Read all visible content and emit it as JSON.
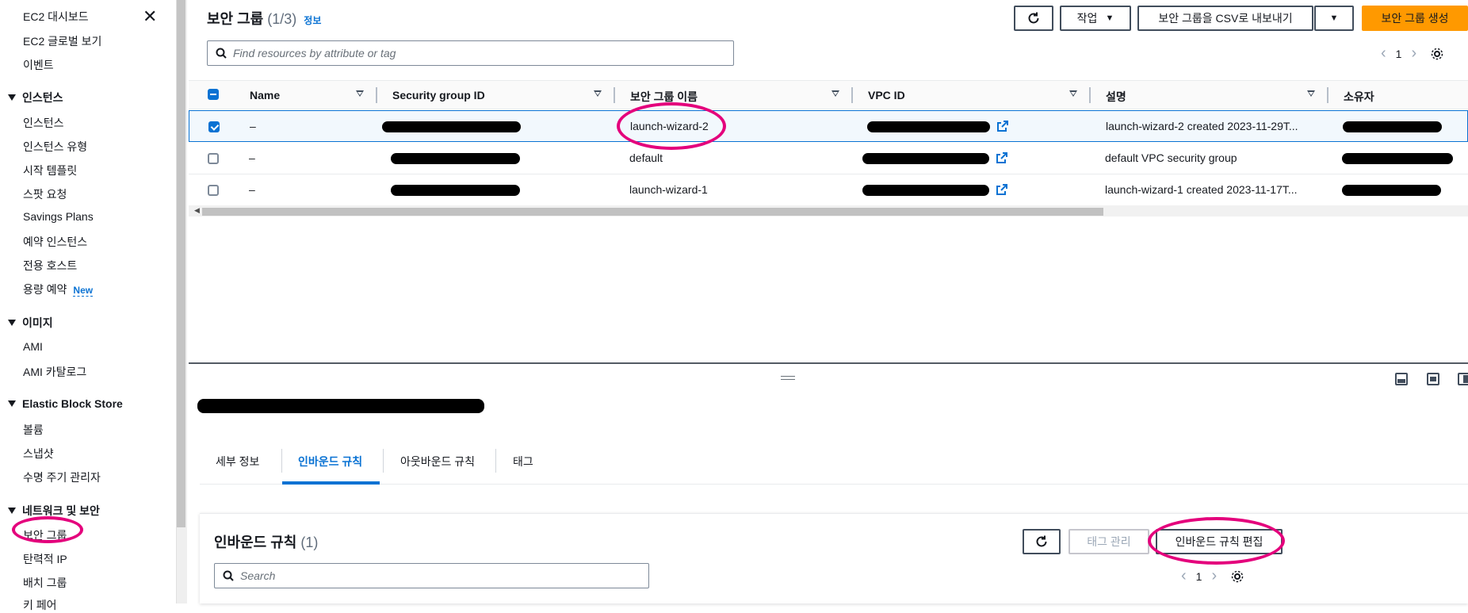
{
  "sidebar": {
    "top_items": [
      "EC2 대시보드",
      "EC2 글로벌 보기",
      "이벤트"
    ],
    "sections": [
      {
        "title": "인스턴스",
        "items": [
          "인스턴스",
          "인스턴스 유형",
          "시작 템플릿",
          "스팟 요청",
          "Savings Plans",
          "예약 인스턴스",
          "전용 호스트",
          "용량 예약"
        ]
      },
      {
        "title": "이미지",
        "items": [
          "AMI",
          "AMI 카탈로그"
        ]
      },
      {
        "title": "Elastic Block Store",
        "items": [
          "볼륨",
          "스냅샷",
          "수명 주기 관리자"
        ]
      },
      {
        "title": "네트워크 및 보안",
        "items": [
          "보안 그룹",
          "탄력적 IP",
          "배치 그룹",
          "키 페어"
        ]
      }
    ],
    "new_badge": "New"
  },
  "header": {
    "title": "보안 그룹",
    "count": "(1/3)",
    "info_link": "정보",
    "buttons": {
      "actions": "작업",
      "export": "보안 그룹을 CSV로 내보내기",
      "create": "보안 그룹 생성"
    },
    "search_placeholder": "Find resources by attribute or tag",
    "page": "1"
  },
  "table": {
    "columns": [
      "Name",
      "Security group ID",
      "보안 그룹 이름",
      "VPC ID",
      "설명",
      "소유자"
    ],
    "rows": [
      {
        "name": "–",
        "group_name": "launch-wizard-2",
        "description": "launch-wizard-2 created 2023-11-29T...",
        "selected": true
      },
      {
        "name": "–",
        "group_name": "default",
        "description": "default VPC security group",
        "selected": false
      },
      {
        "name": "–",
        "group_name": "launch-wizard-1",
        "description": "launch-wizard-1 created 2023-11-17T...",
        "selected": false
      }
    ]
  },
  "detail": {
    "tabs": [
      "세부 정보",
      "인바운드 규칙",
      "아웃바운드 규칙",
      "태그"
    ],
    "active_tab": "인바운드 규칙",
    "inbound": {
      "title": "인바운드 규칙",
      "count": "(1)",
      "manage_tags": "태그 관리",
      "edit_rules": "인바운드 규칙 편집",
      "search_placeholder": "Search",
      "page": "1"
    }
  },
  "colors": {
    "accent": "#0972d3",
    "primary": "#ff9900",
    "highlight": "#e4007c"
  }
}
